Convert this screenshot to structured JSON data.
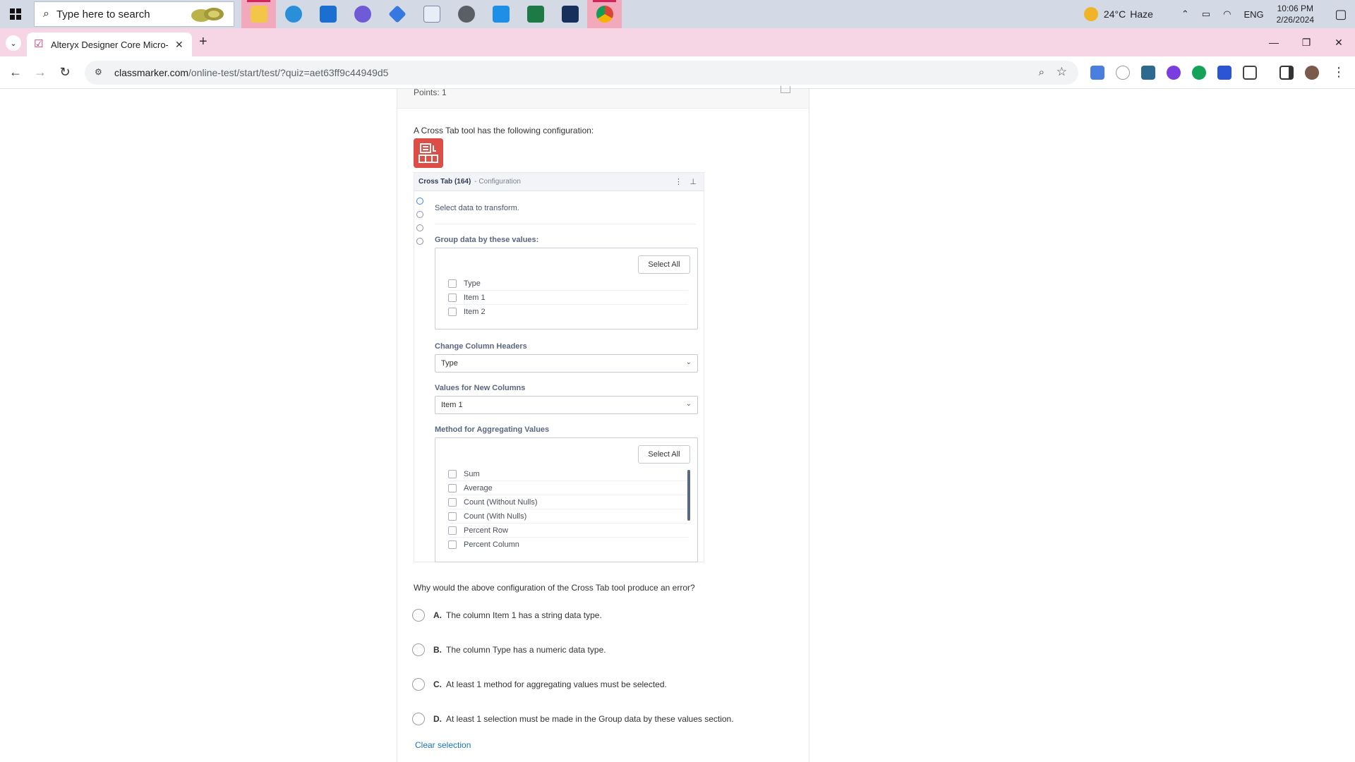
{
  "taskbar": {
    "search_placeholder": "Type here to search",
    "weather_temp": "24°C",
    "weather_desc": "Haze",
    "language": "ENG",
    "time": "10:06 PM",
    "date": "2/26/2024"
  },
  "browser": {
    "tab_title": "Alteryx Designer Core Micro-Cr",
    "url_host": "classmarker.com",
    "url_path": "/online-test/start/test/?quiz=aet63ff9c44949d5"
  },
  "quiz": {
    "points": "Points: 1",
    "question_intro": "A Cross Tab tool has the following configuration:",
    "question": "Why would the above configuration of the Cross Tab tool produce an error?",
    "options": [
      {
        "letter": "A.",
        "text": "The column Item 1 has a string data type."
      },
      {
        "letter": "B.",
        "text": "The column Type has a numeric data type."
      },
      {
        "letter": "C.",
        "text": "At least 1 method for aggregating values must be selected."
      },
      {
        "letter": "D.",
        "text": "At least 1 selection must be made in the Group data by these values section."
      }
    ],
    "clear_selection": "Clear selection"
  },
  "config": {
    "tool_name": "Cross Tab (164)",
    "subtitle": "- Configuration",
    "intro": "Select data to transform.",
    "group_label": "Group data by these values:",
    "select_all": "Select All",
    "group_fields": [
      "Type",
      "Item 1",
      "Item 2"
    ],
    "headers_label": "Change Column Headers",
    "headers_value": "Type",
    "values_label": "Values for New Columns",
    "values_value": "Item 1",
    "method_label": "Method for Aggregating Values",
    "methods": [
      "Sum",
      "Average",
      "Count (Without Nulls)",
      "Count (With Nulls)",
      "Percent Row",
      "Percent Column"
    ]
  }
}
